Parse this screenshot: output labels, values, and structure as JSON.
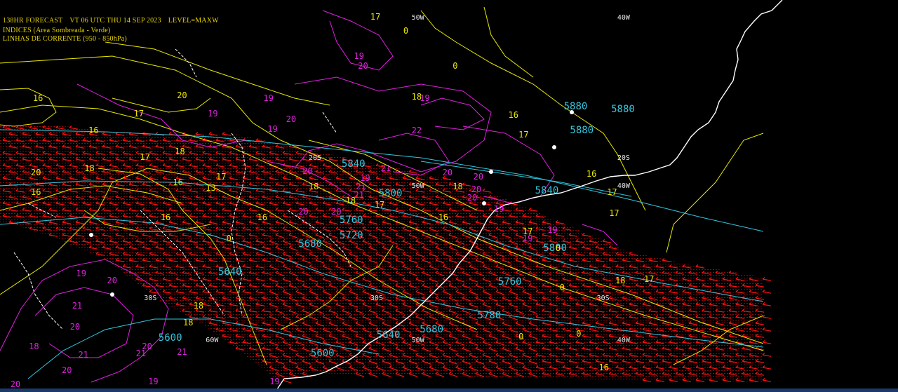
{
  "header": {
    "forecast": "138HR FORECAST",
    "valid_time": "VT 06 UTC THU 14 SEP 2023",
    "level": "LEVEL=MAXW",
    "legend_shaded": "INDICES (Area Sombreada - Verde)",
    "legend_streamlines": "LINHAS DE CORRENTE (950 - 850hPa)"
  },
  "colors": {
    "background": "#000000",
    "coast": "#ffffff",
    "yellow_contour": "#e8e800",
    "magenta_contour": "#e020e0",
    "cyan_contour": "#30c8e0",
    "wind_barbs": "#ff1010",
    "shading": "#d81010"
  },
  "grid_labels": [
    {
      "text": "50W",
      "lon": -50,
      "lat": -10
    },
    {
      "text": "40W",
      "lon": -40,
      "lat": -10
    },
    {
      "text": "20S",
      "lon": -55,
      "lat": -20
    },
    {
      "text": "20S",
      "lon": -40,
      "lat": -20
    },
    {
      "text": "20S",
      "lon": -24,
      "lat": -20
    },
    {
      "text": "50W",
      "lon": -50,
      "lat": -22
    },
    {
      "text": "40W",
      "lon": -40,
      "lat": -22
    },
    {
      "text": "30S",
      "lon": -63,
      "lat": -30
    },
    {
      "text": "30S",
      "lon": -52,
      "lat": -30
    },
    {
      "text": "30S",
      "lon": -41,
      "lat": -30
    },
    {
      "text": "30S",
      "lon": -24,
      "lat": -30
    },
    {
      "text": "60W",
      "lon": -60,
      "lat": -33
    },
    {
      "text": "50W",
      "lon": -50,
      "lat": -33
    },
    {
      "text": "40W",
      "lon": -40,
      "lat": -33
    }
  ],
  "height_labels": [
    {
      "text": "5880",
      "lon": -42.6,
      "lat": -16.4
    },
    {
      "text": "5880",
      "lon": -40.3,
      "lat": -16.6
    },
    {
      "text": "5880",
      "lon": -42.3,
      "lat": -18.1
    },
    {
      "text": "5840",
      "lon": -53.4,
      "lat": -20.5
    },
    {
      "text": "5840",
      "lon": -44.0,
      "lat": -22.4
    },
    {
      "text": "5800",
      "lon": -51.6,
      "lat": -22.6
    },
    {
      "text": "5760",
      "lon": -53.5,
      "lat": -24.5
    },
    {
      "text": "5720",
      "lon": -53.5,
      "lat": -25.6
    },
    {
      "text": "5800",
      "lon": -43.6,
      "lat": -26.5
    },
    {
      "text": "5680",
      "lon": -55.5,
      "lat": -26.2
    },
    {
      "text": "5640",
      "lon": -59.4,
      "lat": -28.2
    },
    {
      "text": "5760",
      "lon": -45.8,
      "lat": -28.9
    },
    {
      "text": "5780",
      "lon": -46.8,
      "lat": -31.3
    },
    {
      "text": "5680",
      "lon": -49.6,
      "lat": -32.3
    },
    {
      "text": "5640",
      "lon": -51.7,
      "lat": -32.7
    },
    {
      "text": "5600",
      "lon": -62.3,
      "lat": -32.9
    },
    {
      "text": "5600",
      "lon": -54.9,
      "lat": -34.0
    }
  ],
  "yellow_labels": [
    {
      "text": "17",
      "lon": -52.0,
      "lat": -10.0
    },
    {
      "text": "0",
      "lon": -50.4,
      "lat": -11.0
    },
    {
      "text": "16",
      "lon": -68.4,
      "lat": -15.8
    },
    {
      "text": "20",
      "lon": -61.4,
      "lat": -15.6
    },
    {
      "text": "18",
      "lon": -50.0,
      "lat": -15.7
    },
    {
      "text": "0",
      "lon": -48.0,
      "lat": -13.5
    },
    {
      "text": "17",
      "lon": -63.5,
      "lat": -16.9
    },
    {
      "text": "16",
      "lon": -45.3,
      "lat": -17.0
    },
    {
      "text": "16",
      "lon": -65.7,
      "lat": -18.1
    },
    {
      "text": "17",
      "lon": -44.8,
      "lat": -18.4
    },
    {
      "text": "18",
      "lon": -61.5,
      "lat": -19.6
    },
    {
      "text": "17",
      "lon": -63.2,
      "lat": -20.0
    },
    {
      "text": "20",
      "lon": -68.5,
      "lat": -21.1
    },
    {
      "text": "18",
      "lon": -65.9,
      "lat": -20.8
    },
    {
      "text": "17",
      "lon": -59.5,
      "lat": -21.4
    },
    {
      "text": "16",
      "lon": -61.6,
      "lat": -21.8
    },
    {
      "text": "13",
      "lon": -60.0,
      "lat": -22.2
    },
    {
      "text": "18",
      "lon": -55.0,
      "lat": -22.1
    },
    {
      "text": "16",
      "lon": -41.5,
      "lat": -21.2
    },
    {
      "text": "17",
      "lon": -40.5,
      "lat": -22.5
    },
    {
      "text": "16",
      "lon": -68.5,
      "lat": -22.5
    },
    {
      "text": "17",
      "lon": -51.8,
      "lat": -23.4
    },
    {
      "text": "17",
      "lon": -40.4,
      "lat": -24.0
    },
    {
      "text": "18",
      "lon": -48.0,
      "lat": -22.1
    },
    {
      "text": "16",
      "lon": -62.2,
      "lat": -24.3
    },
    {
      "text": "16",
      "lon": -57.5,
      "lat": -24.3
    },
    {
      "text": "18",
      "lon": -53.2,
      "lat": -23.1
    },
    {
      "text": "16",
      "lon": -48.7,
      "lat": -24.3
    },
    {
      "text": "17",
      "lon": -44.6,
      "lat": -25.3
    },
    {
      "text": "0",
      "lon": -59.0,
      "lat": -25.8
    },
    {
      "text": "0",
      "lon": -43.0,
      "lat": -26.5
    },
    {
      "text": "18",
      "lon": -40.1,
      "lat": -28.8
    },
    {
      "text": "17",
      "lon": -38.7,
      "lat": -28.7
    },
    {
      "text": "0",
      "lon": -42.8,
      "lat": -29.3
    },
    {
      "text": "18",
      "lon": -60.6,
      "lat": -30.6
    },
    {
      "text": "18",
      "lon": -61.1,
      "lat": -31.8
    },
    {
      "text": "0",
      "lon": -44.8,
      "lat": -32.8
    },
    {
      "text": "0",
      "lon": -42.0,
      "lat": -32.6
    },
    {
      "text": "16",
      "lon": -40.9,
      "lat": -35.0
    }
  ],
  "magenta_labels": [
    {
      "text": "19",
      "lon": -52.8,
      "lat": -12.8
    },
    {
      "text": "20",
      "lon": -52.6,
      "lat": -13.5
    },
    {
      "text": "19",
      "lon": -57.2,
      "lat": -15.8
    },
    {
      "text": "19",
      "lon": -49.6,
      "lat": -15.8
    },
    {
      "text": "19",
      "lon": -59.9,
      "lat": -16.9
    },
    {
      "text": "20",
      "lon": -56.1,
      "lat": -17.3
    },
    {
      "text": "19",
      "lon": -57.0,
      "lat": -18.0
    },
    {
      "text": "22",
      "lon": -50.0,
      "lat": -18.1
    },
    {
      "text": "20",
      "lon": -55.3,
      "lat": -21.0
    },
    {
      "text": "21",
      "lon": -51.5,
      "lat": -20.8
    },
    {
      "text": "20",
      "lon": -48.5,
      "lat": -21.1
    },
    {
      "text": "20",
      "lon": -47.0,
      "lat": -21.4
    },
    {
      "text": "19",
      "lon": -52.5,
      "lat": -21.5
    },
    {
      "text": "21",
      "lon": -52.7,
      "lat": -22.1
    },
    {
      "text": "20",
      "lon": -47.1,
      "lat": -22.3
    },
    {
      "text": "21",
      "lon": -52.8,
      "lat": -22.7
    },
    {
      "text": "20",
      "lon": -47.3,
      "lat": -22.9
    },
    {
      "text": "20",
      "lon": -55.5,
      "lat": -23.9
    },
    {
      "text": "20",
      "lon": -53.9,
      "lat": -23.9
    },
    {
      "text": "19",
      "lon": -46.0,
      "lat": -23.7
    },
    {
      "text": "19",
      "lon": -44.6,
      "lat": -25.8
    },
    {
      "text": "19",
      "lon": -43.4,
      "lat": -25.2
    },
    {
      "text": "19",
      "lon": -66.3,
      "lat": -28.3
    },
    {
      "text": "20",
      "lon": -64.8,
      "lat": -28.8
    },
    {
      "text": "21",
      "lon": -66.5,
      "lat": -30.6
    },
    {
      "text": "20",
      "lon": -66.6,
      "lat": -32.1
    },
    {
      "text": "20",
      "lon": -63.1,
      "lat": -33.5
    },
    {
      "text": "21",
      "lon": -66.2,
      "lat": -34.1
    },
    {
      "text": "21",
      "lon": -63.4,
      "lat": -34.0
    },
    {
      "text": "21",
      "lon": -61.4,
      "lat": -33.9
    },
    {
      "text": "18",
      "lon": -68.6,
      "lat": -33.5
    },
    {
      "text": "20",
      "lon": -67.0,
      "lat": -35.2
    },
    {
      "text": "19",
      "lon": -62.8,
      "lat": -36.0
    },
    {
      "text": "19",
      "lon": -56.9,
      "lat": -36.0
    },
    {
      "text": "20",
      "lon": -69.5,
      "lat": -36.2
    }
  ]
}
